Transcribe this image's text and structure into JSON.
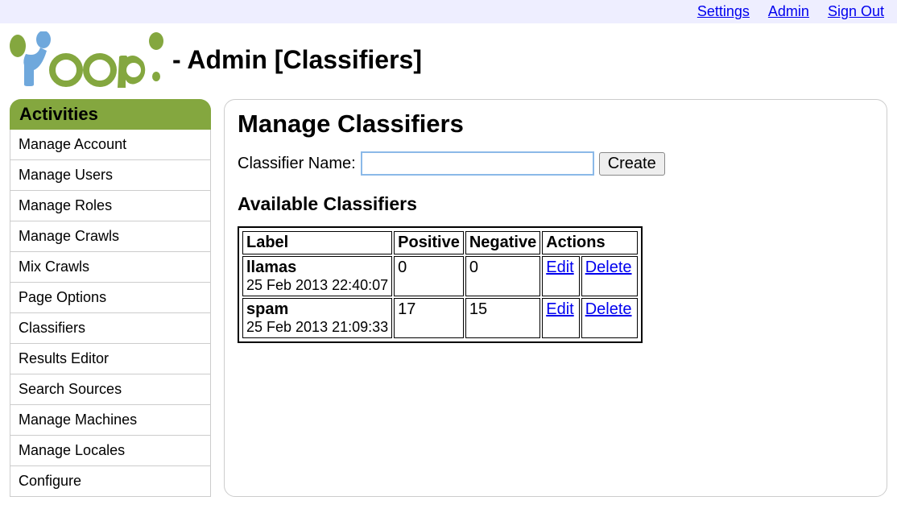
{
  "topbar": {
    "settings": "Settings",
    "admin": "Admin",
    "sign_out": "Sign Out"
  },
  "header": {
    "title": "- Admin [Classifiers]"
  },
  "sidebar": {
    "title": "Activities",
    "items": [
      {
        "label": "Manage Account"
      },
      {
        "label": "Manage Users"
      },
      {
        "label": "Manage Roles"
      },
      {
        "label": "Manage Crawls"
      },
      {
        "label": "Mix Crawls"
      },
      {
        "label": "Page Options"
      },
      {
        "label": "Classifiers"
      },
      {
        "label": "Results Editor"
      },
      {
        "label": "Search Sources"
      },
      {
        "label": "Manage Machines"
      },
      {
        "label": "Manage Locales"
      },
      {
        "label": "Configure"
      }
    ]
  },
  "main": {
    "heading": "Manage Classifiers",
    "form": {
      "label": "Classifier Name:",
      "value": "",
      "create_label": "Create"
    },
    "available_heading": "Available Classifiers",
    "table": {
      "headers": {
        "label": "Label",
        "positive": "Positive",
        "negative": "Negative",
        "actions": "Actions"
      },
      "rows": [
        {
          "label": "llamas",
          "timestamp": "25 Feb 2013 22:40:07",
          "positive": "0",
          "negative": "0",
          "edit": "Edit",
          "delete": "Delete"
        },
        {
          "label": "spam",
          "timestamp": "25 Feb 2013 21:09:33",
          "positive": "17",
          "negative": "15",
          "edit": "Edit",
          "delete": "Delete"
        }
      ]
    }
  }
}
